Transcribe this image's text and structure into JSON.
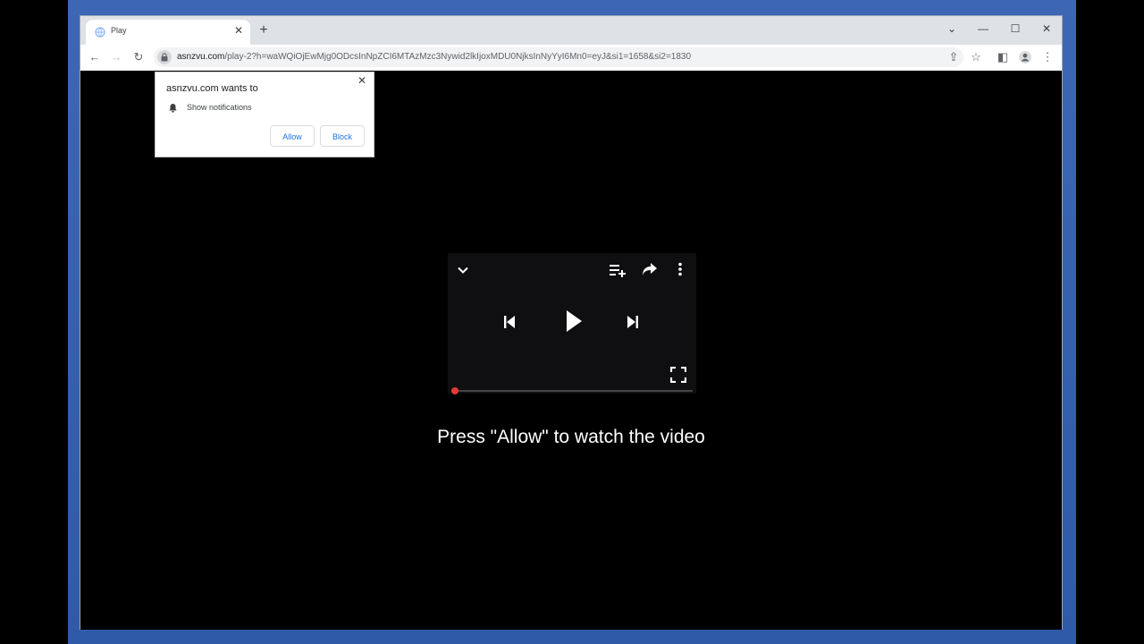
{
  "browser": {
    "tab_title": "Play",
    "url_host": "asnzvu.com",
    "url_rest": "/play-2?h=waWQiOjEwMjg0ODcsInNpZCI6MTAzMzc3Nywid2lkIjoxMDU0NjksInNyYyI6Mn0=eyJ&si1=1658&si2=1830"
  },
  "popup": {
    "title": "asnzvu.com wants to",
    "permission": "Show notifications",
    "allow_label": "Allow",
    "block_label": "Block"
  },
  "page": {
    "caption": "Press \"Allow\" to watch the video"
  },
  "player": {
    "progress": 0
  },
  "icons": {
    "favicon": "globe-icon",
    "lock": "lock-icon",
    "bell": "bell-icon"
  },
  "colors": {
    "desktop": "#3d67b5",
    "progress": "#e53935",
    "link_blue": "#1a73e8"
  }
}
